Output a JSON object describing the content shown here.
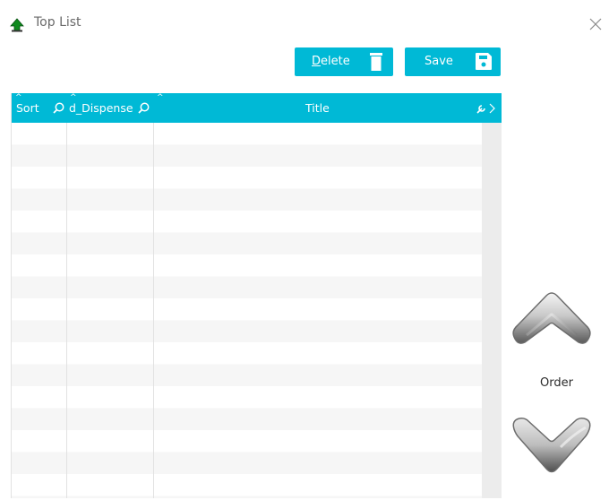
{
  "window": {
    "title": "Top List"
  },
  "toolbar": {
    "delete_mnemonic": "D",
    "delete_rest": "elete",
    "save_label": "Save"
  },
  "grid": {
    "columns": [
      {
        "label": "Sort"
      },
      {
        "label": "d_Dispense"
      },
      {
        "label": "Title"
      }
    ]
  },
  "order": {
    "label": "Order"
  },
  "colors": {
    "accent": "#00b9d6",
    "row_alt": "#f6f6f6",
    "grid_line": "#e2e2e2"
  },
  "icons": {
    "app": "green-arrow-up-icon",
    "close": "close-icon",
    "delete": "trash-icon",
    "save": "floppy-disk-icon",
    "column_search": "magnifier-icon",
    "column_menu": "wrench-icon",
    "scroll_right": "chevron-right-icon",
    "order_up": "chevron-up-icon",
    "order_down": "chevron-down-icon"
  }
}
